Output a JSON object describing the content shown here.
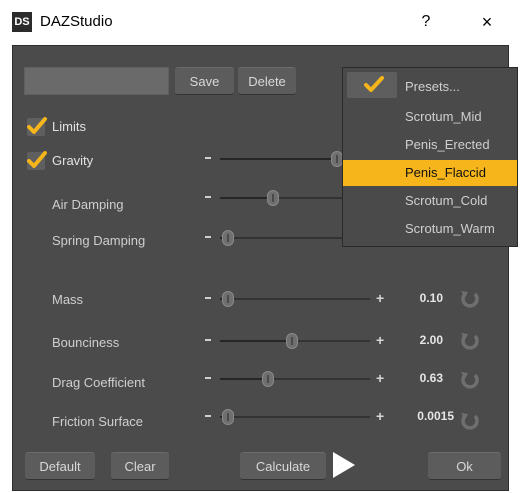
{
  "window": {
    "logo_text": "DS",
    "title": "DAZStudio",
    "help_label": "?",
    "close_label": "×"
  },
  "preset_bar": {
    "name_value": "",
    "save_label": "Save",
    "delete_label": "Delete"
  },
  "checkboxes": [
    {
      "label": "Limits",
      "checked": true
    },
    {
      "label": "Gravity",
      "checked": true
    }
  ],
  "sliders": [
    {
      "label": "Gravity",
      "value": null,
      "fraction": 0.78
    },
    {
      "label": "Air Damping",
      "value": null,
      "fraction": 0.35
    },
    {
      "label": "Spring Damping",
      "value": null,
      "fraction": 0.05
    },
    {
      "label": "Mass",
      "value": "0.10",
      "fraction": 0.05
    },
    {
      "label": "Bounciness",
      "value": "2.00",
      "fraction": 0.48
    },
    {
      "label": "Drag Coefficient",
      "value": "0.63",
      "fraction": 0.32
    },
    {
      "label": "Friction Surface",
      "value": "0.0015",
      "fraction": 0.05
    }
  ],
  "presets_dropdown": {
    "selected": "Penis_Flaccid",
    "items": [
      "Presets...",
      "Scrotum_Mid",
      "Penis_Erected",
      "Penis_Flaccid",
      "Scrotum_Cold",
      "Scrotum_Warm"
    ]
  },
  "footer": {
    "default_label": "Default",
    "clear_label": "Clear",
    "calculate_label": "Calculate",
    "ok_label": "Ok"
  },
  "colors": {
    "accent": "#f5b51b",
    "panel": "#4b4b4b",
    "button": "#5c5c5c"
  }
}
